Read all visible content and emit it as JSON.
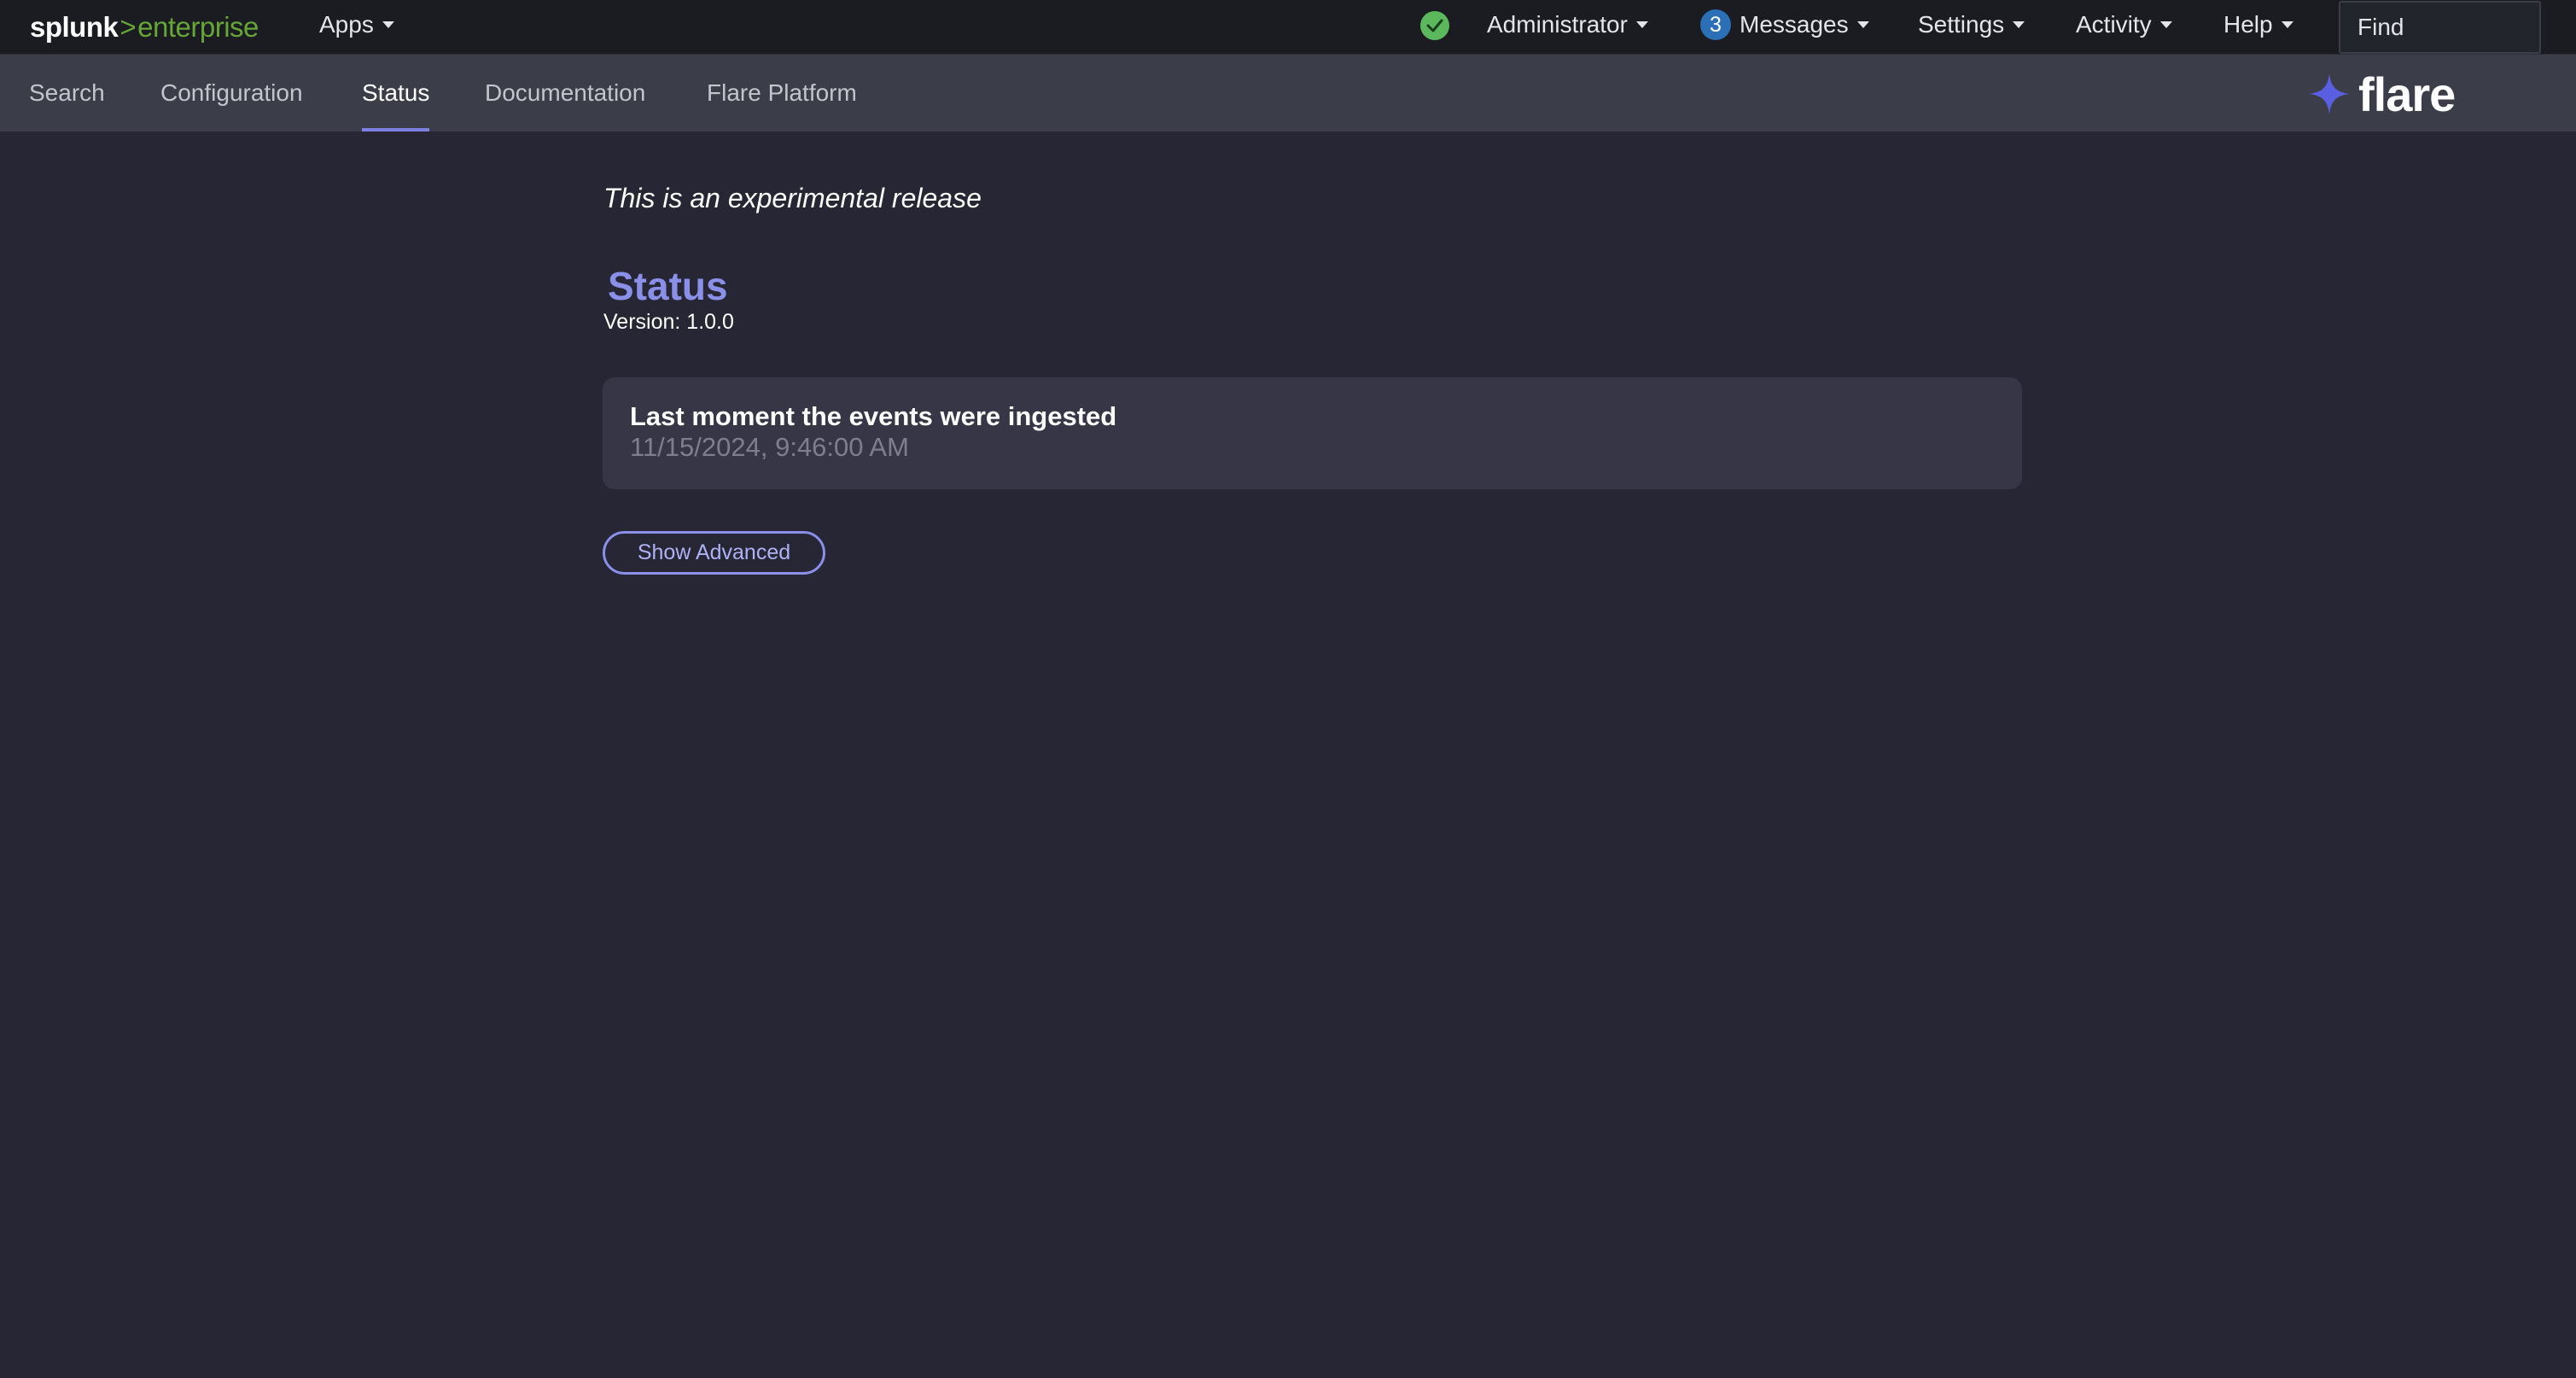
{
  "topbar": {
    "logo": {
      "splunk": "splunk",
      "separator": ">",
      "product": "enterprise"
    },
    "apps_label": "Apps",
    "health_status": "ok",
    "user_label": "Administrator",
    "messages_count": "3",
    "messages_label": "Messages",
    "settings_label": "Settings",
    "activity_label": "Activity",
    "help_label": "Help",
    "find_placeholder": "Find"
  },
  "appnav": {
    "tabs": [
      {
        "label": "Search"
      },
      {
        "label": "Configuration"
      },
      {
        "label": "Status"
      },
      {
        "label": "Documentation"
      },
      {
        "label": "Flare Platform"
      }
    ],
    "active_tab": "Status",
    "brand": "flare"
  },
  "main": {
    "notice": "This is an experimental release",
    "title": "Status",
    "version_label": "Version:",
    "version_value": "1.0.0",
    "ingest_card": {
      "title": "Last moment the events were ingested",
      "value": "11/15/2024, 9:46:00 AM"
    },
    "advanced_button": "Show Advanced"
  },
  "colors": {
    "background": "#262634",
    "topbar": "#1a1c21",
    "appbar": "#3b3e48",
    "accent": "#8a8fe8",
    "splunk_green": "#65a637",
    "health_green": "#5cb85c",
    "badge_blue": "#2b6fb6",
    "flare_star": "#5a5ee0"
  }
}
